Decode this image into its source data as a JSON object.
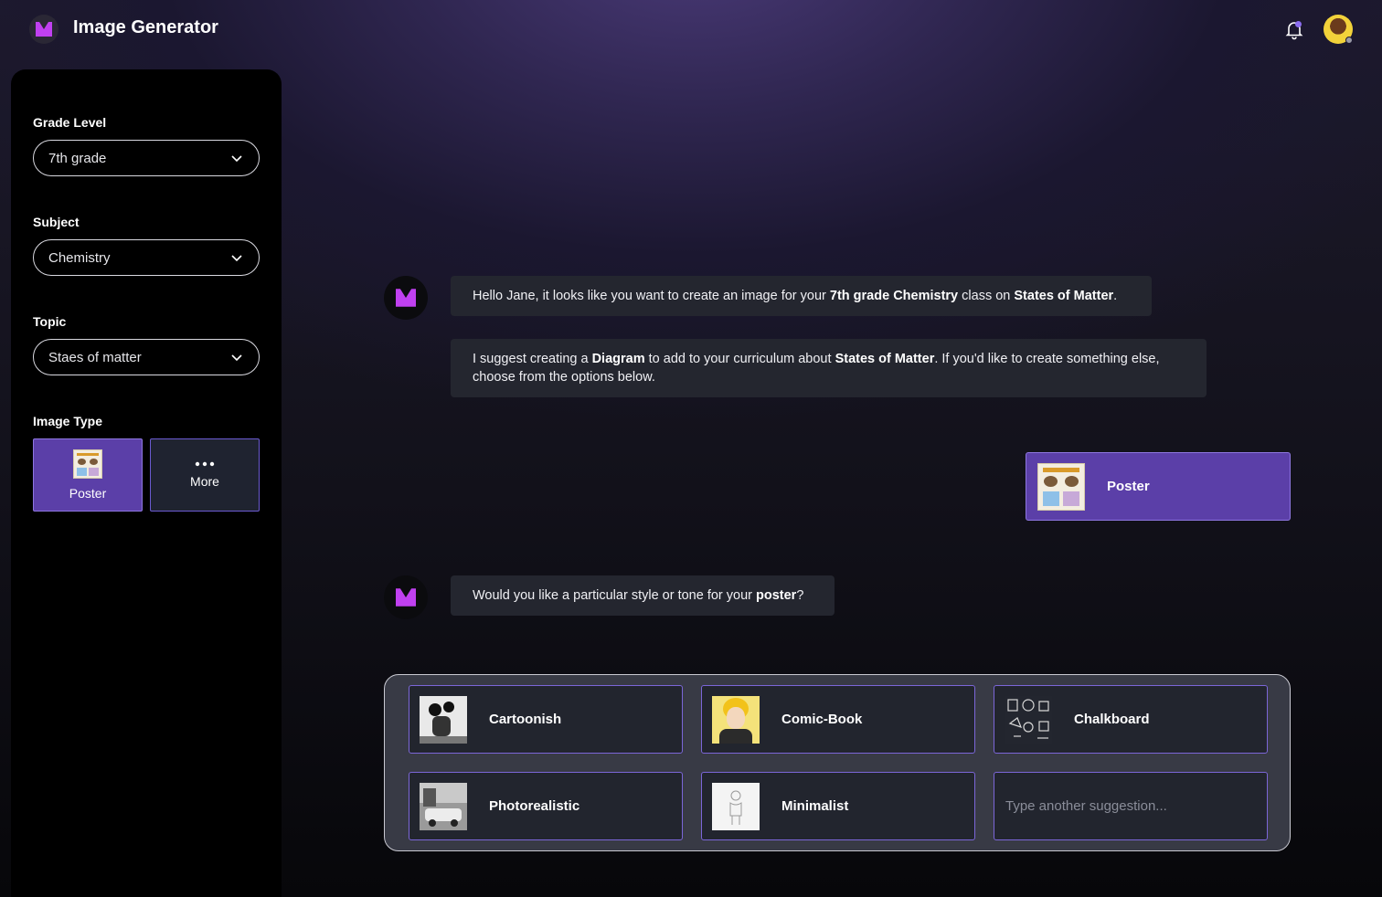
{
  "app": {
    "title": "Image Generator",
    "logo_icon": "m-logo-icon",
    "accent": "#5b3fa8",
    "logo_color": "#c040f0"
  },
  "sidebar": {
    "grade_label": "Grade Level",
    "grade_value": "7th grade",
    "subject_label": "Subject",
    "subject_value": "Chemistry",
    "topic_label": "Topic",
    "topic_value": "Staes of matter",
    "image_type_label": "Image Type",
    "image_types": [
      {
        "label": "Poster",
        "icon": "poster-thumbnail",
        "selected": true
      },
      {
        "label": "More",
        "icon": "more-dots-icon",
        "selected": false
      }
    ]
  },
  "chat": {
    "msg1": {
      "pre": "Hello Jane, it looks like you want to create an image for your ",
      "b1": "7th grade Chemistry",
      "mid": " class on ",
      "b2": "States of Matter",
      "post": "."
    },
    "msg2": {
      "pre": "I suggest creating a ",
      "b1": "Diagram",
      "mid": " to add to your curriculum about ",
      "b2": "States of Matter",
      "post": ". If you'd like to create something else, choose from the options below."
    },
    "user_choice": "Poster",
    "msg3": {
      "pre": "Would you like a particular style or tone for your ",
      "b1": "poster",
      "post": "?"
    }
  },
  "styles": {
    "options": [
      {
        "label": "Cartoonish",
        "icon": "cartoon-thumbnail"
      },
      {
        "label": "Comic-Book",
        "icon": "comic-thumbnail"
      },
      {
        "label": "Chalkboard",
        "icon": "chalkboard-thumbnail"
      },
      {
        "label": "Photorealistic",
        "icon": "photo-thumbnail"
      },
      {
        "label": "Minimalist",
        "icon": "minimal-thumbnail"
      }
    ],
    "input_placeholder": "Type another suggestion..."
  }
}
